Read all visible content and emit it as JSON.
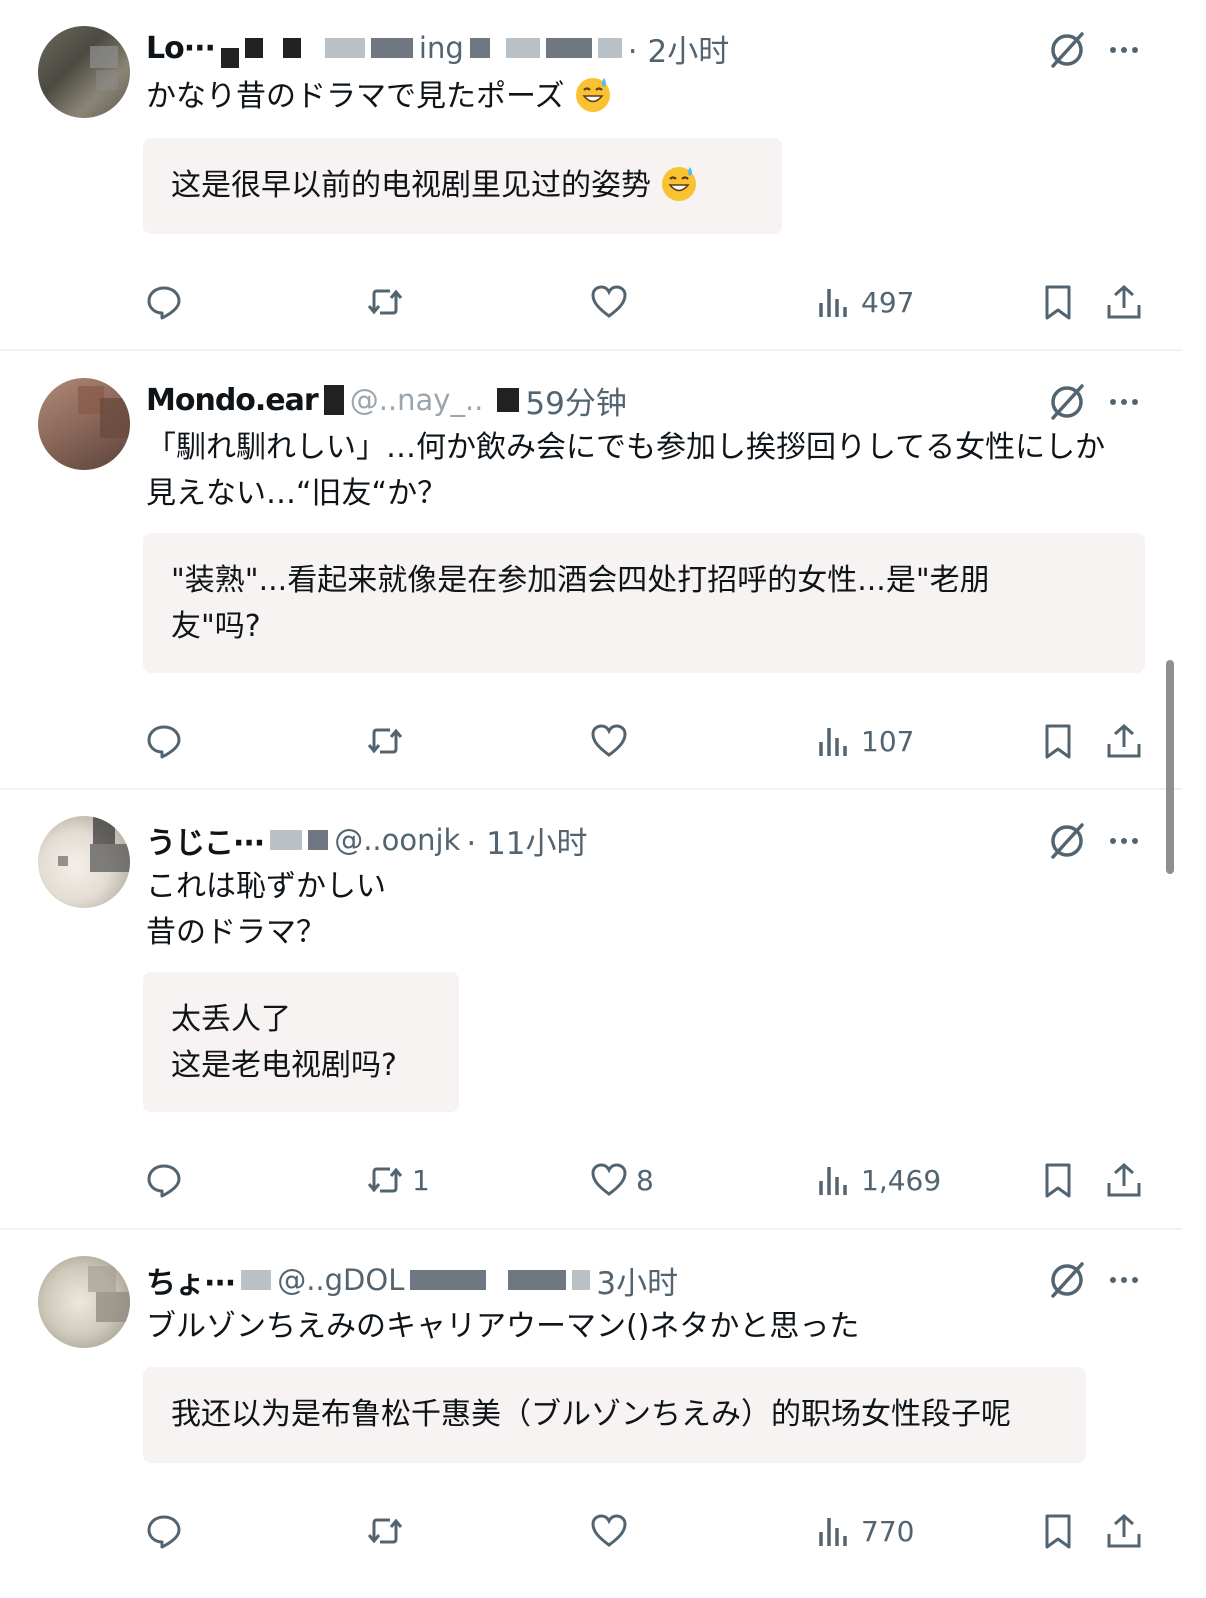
{
  "posts": [
    {
      "name": "Lo···",
      "handle": "ing",
      "time": "· 2小时",
      "text_jp": "かなり昔のドラマで見たポーズ",
      "translation": "这是很早以前的电视剧里见过的姿势",
      "stats": {
        "replies": "",
        "reposts": "",
        "likes": "",
        "views": "497"
      }
    },
    {
      "name": "Mondo.ear",
      "handle": "@..nay_..",
      "time": "59分钟",
      "text_jp": "「馴れ馴れしい」…何か飲み会にでも参加し挨拶回りしてる女性にしか\n見えない…“旧友“か？",
      "translation": "\"装熟\"...看起来就像是在参加酒会四处打招呼的女性...是\"老朋\n友\"吗?",
      "stats": {
        "replies": "",
        "reposts": "",
        "likes": "",
        "views": "107"
      }
    },
    {
      "name": "うじこ···",
      "handle": "@..oonjk",
      "time": "· 11小时",
      "text_jp": "これは恥ずかしい\n昔のドラマ？",
      "translation": "太丢人了\n这是老电视剧吗?",
      "stats": {
        "replies": "",
        "reposts": "1",
        "likes": "8",
        "views": "1,469"
      }
    },
    {
      "name": "ちょ···",
      "handle": "@..gDOL",
      "time": "3小时",
      "text_jp": "ブルゾンちえみのキャリアウーマン()ネタかと思った",
      "translation": "我还以为是布鲁松千惠美（ブルゾンちえみ）的职场女性段子呢",
      "stats": {
        "replies": "",
        "reposts": "",
        "likes": "",
        "views": "770"
      }
    }
  ],
  "icons": {
    "reply": "reply-icon",
    "repost": "repost-icon",
    "like": "heart-icon",
    "views": "views-icon",
    "bookmark": "bookmark-icon",
    "share": "share-icon",
    "grok": "grok-icon",
    "more": "more-icon"
  },
  "colors": {
    "secondary_text": "#536471",
    "translation_bg": "#f7f3f2",
    "divider": "#eff3f4"
  }
}
